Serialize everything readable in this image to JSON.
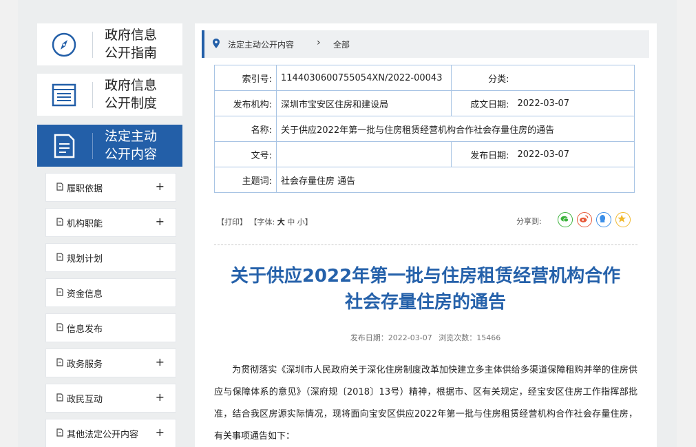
{
  "sidebar": {
    "guides": [
      {
        "line1": "政府信息",
        "line2": "公开指南",
        "icon": "compass-icon"
      },
      {
        "line1": "政府信息",
        "line2": "公开制度",
        "icon": "document-list-icon"
      },
      {
        "line1": "法定主动",
        "line2": "公开内容",
        "icon": "document-icon"
      }
    ],
    "menu": [
      {
        "label": "履职依据",
        "plus": "+"
      },
      {
        "label": "机构职能",
        "plus": "+"
      },
      {
        "label": "规划计划",
        "plus": ""
      },
      {
        "label": "资金信息",
        "plus": ""
      },
      {
        "label": "信息发布",
        "plus": ""
      },
      {
        "label": "政务服务",
        "plus": "+"
      },
      {
        "label": "政民互动",
        "plus": "+"
      },
      {
        "label": "其他法定公开内容",
        "plus": "+"
      }
    ]
  },
  "breadcrumb": {
    "section": "法定主动公开内容",
    "separator": "›",
    "current": "全部"
  },
  "meta": {
    "index_label": "索引号:",
    "index_value": "1144030600755054XN/2022-00043",
    "category_label": "分类:",
    "category_value": "",
    "org_label": "发布机构:",
    "org_value": "深圳市宝安区住房和建设局",
    "date_written_label": "成文日期:",
    "date_written_value": "2022-03-07",
    "name_label": "名称:",
    "name_value": "关于供应2022年第一批与住房租赁经营机构合作社会存量住房的通告",
    "doc_no_label": "文号:",
    "doc_no_value": "",
    "publish_date_label": "发布日期:",
    "publish_date_value": "2022-03-07",
    "keywords_label": "主题词:",
    "keywords_value": "社会存量住房 通告"
  },
  "tools": {
    "print": "【打印】",
    "font_prefix": "【字体:",
    "font_large": "大",
    "font_medium": "中",
    "font_small": "小】",
    "share_label": "分享到:"
  },
  "share_icons": [
    {
      "name": "wechat-icon",
      "color": "#3db33d"
    },
    {
      "name": "weibo-icon",
      "color": "#e85a3a"
    },
    {
      "name": "qq-icon",
      "color": "#3a8ee8"
    },
    {
      "name": "qzone-icon",
      "color": "#f1b82b"
    }
  ],
  "article": {
    "title_line1": "关于供应2022年第一批与住房租赁经营机构合作",
    "title_line2": "社会存量住房的通告",
    "publish_info": "发布日期：2022-03-07",
    "views_info": "浏览次数：15466",
    "body": "为贯彻落实《深圳市人民政府关于深化住房制度改革加快建立多主体供给多渠道保障租购并举的住房供应与保障体系的意见》（深府规〔2018〕13号）精神，根据市、区有关规定，经宝安区住房工作指挥部批准，结合我区房源实际情况，现将面向宝安区供应2022年第一批与住房租赁经营机构合作社会存量住房，有关事项通告如下："
  },
  "colors": {
    "accent": "#235fa8",
    "title": "#2561aa",
    "table_border": "#a8c4e4"
  }
}
